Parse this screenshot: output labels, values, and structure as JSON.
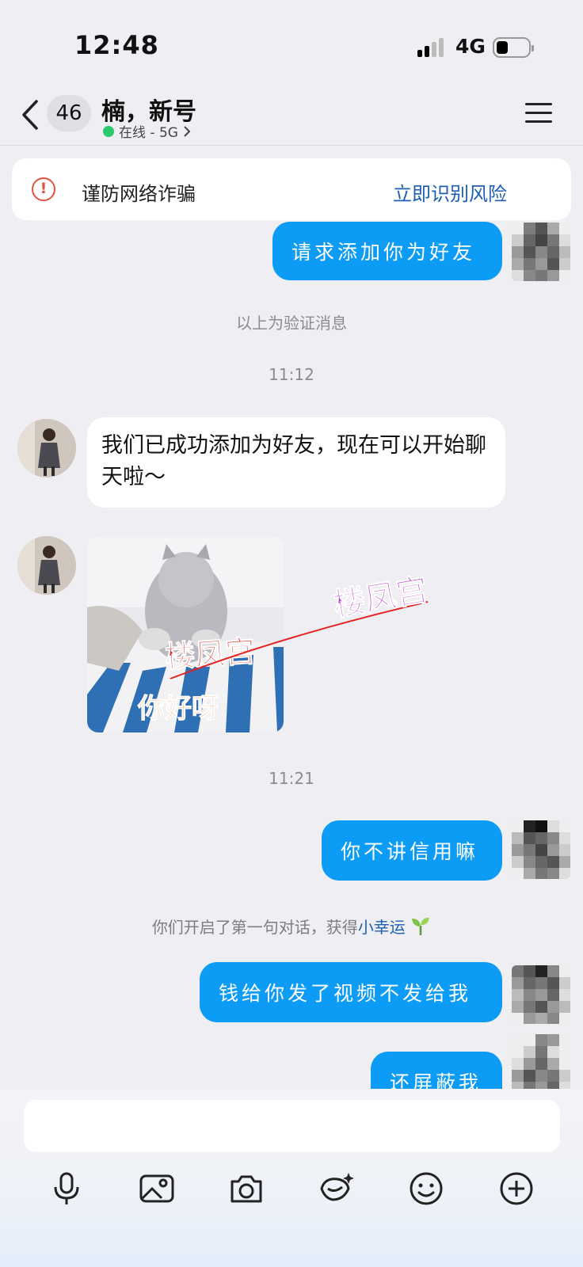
{
  "status_bar": {
    "time": "12:48",
    "network": "4G"
  },
  "header": {
    "unread_count": "46",
    "contact_name": "楠，新号",
    "presence": "在线 - 5G",
    "presence_color": "#2ec96a"
  },
  "warning": {
    "text": "谨防网络诈骗",
    "action": "立即识别风险"
  },
  "messages": {
    "friend_request": "请求添加你为好友",
    "verify_note": "以上为验证消息",
    "time1": "11:12",
    "greeting": "我们已成功添加为好友，现在可以开始聊天啦～",
    "sticker_caption": "你好呀",
    "watermark_1": "楼凤宫",
    "watermark_2": "楼凤宫",
    "time2": "11:21",
    "msg1": "你不讲信用嘛",
    "first_chat_prefix": "你们开启了第一句对话，获得",
    "first_chat_link": "小幸运",
    "msg2": "钱给你发了视频不发给我",
    "msg3": "还屏蔽我"
  },
  "composer": {
    "input_value": "",
    "tools": [
      "microphone-icon",
      "image-icon",
      "camera-icon",
      "ai-assistant-icon",
      "emoji-icon",
      "plus-icon"
    ]
  },
  "colors": {
    "outgoing_bubble": "#0c9cf5",
    "link": "#1d5fb5",
    "warning_icon": "#e0533e"
  }
}
